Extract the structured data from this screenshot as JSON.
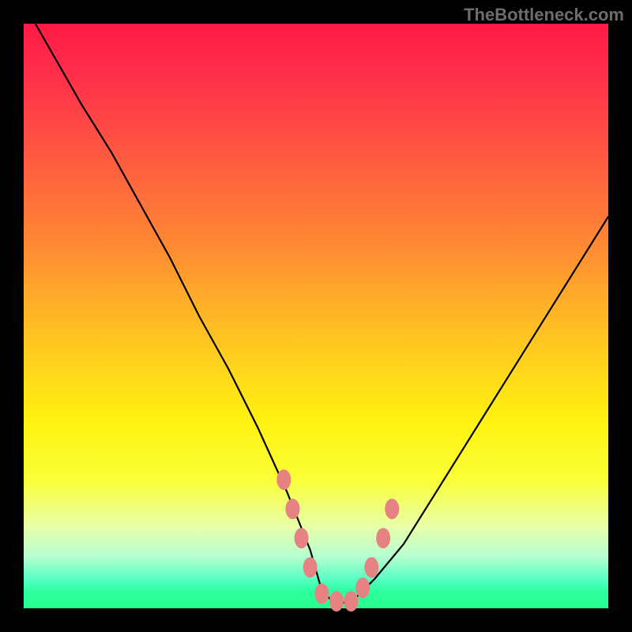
{
  "watermark": "TheBottleneck.com",
  "chart_data": {
    "type": "line",
    "title": "",
    "xlabel": "",
    "ylabel": "",
    "xlim": [
      0,
      100
    ],
    "ylim": [
      0,
      100
    ],
    "grid": false,
    "legend": false,
    "series": [
      {
        "name": "curve",
        "x": [
          2,
          6,
          10,
          15,
          20,
          25,
          30,
          35,
          40,
          45,
          47,
          49,
          51,
          53,
          55,
          57,
          60,
          65,
          70,
          75,
          80,
          85,
          90,
          95,
          100
        ],
        "values": [
          100,
          93,
          86,
          78,
          69,
          60,
          50,
          41,
          31,
          20,
          15,
          10,
          3,
          1,
          1,
          2,
          5,
          11,
          19,
          27,
          35,
          43,
          51,
          59,
          67
        ]
      }
    ],
    "annotations": {
      "beads": [
        {
          "x": 44.5,
          "y": 22
        },
        {
          "x": 46.0,
          "y": 17
        },
        {
          "x": 47.5,
          "y": 12
        },
        {
          "x": 49.0,
          "y": 7
        },
        {
          "x": 51.0,
          "y": 2.5
        },
        {
          "x": 53.5,
          "y": 1.2
        },
        {
          "x": 56.0,
          "y": 1.2
        },
        {
          "x": 58.0,
          "y": 3.5
        },
        {
          "x": 59.5,
          "y": 7
        },
        {
          "x": 61.5,
          "y": 12
        },
        {
          "x": 63.0,
          "y": 17
        }
      ]
    },
    "colors": {
      "gradient_top": "#ff1a45",
      "gradient_mid": "#fff210",
      "gradient_bottom": "#25ff8d",
      "curve": "#000000",
      "beads": "#e68282"
    }
  }
}
